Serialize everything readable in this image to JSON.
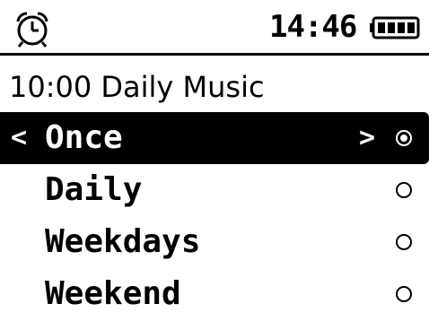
{
  "status_bar": {
    "time": "14:46",
    "alarm_icon": "alarm-clock-icon",
    "battery_icon": "battery-full-icon",
    "battery_level": 1.0
  },
  "header": {
    "title": "10:00 Daily Music"
  },
  "options": [
    {
      "label": "Once",
      "selected": true
    },
    {
      "label": "Daily",
      "selected": false
    },
    {
      "label": "Weekdays",
      "selected": false
    },
    {
      "label": "Weekend",
      "selected": false
    }
  ],
  "navigation": {
    "left_arrow": "<",
    "right_arrow": ">"
  },
  "colors": {
    "foreground": "#000000",
    "background": "#ffffff"
  }
}
